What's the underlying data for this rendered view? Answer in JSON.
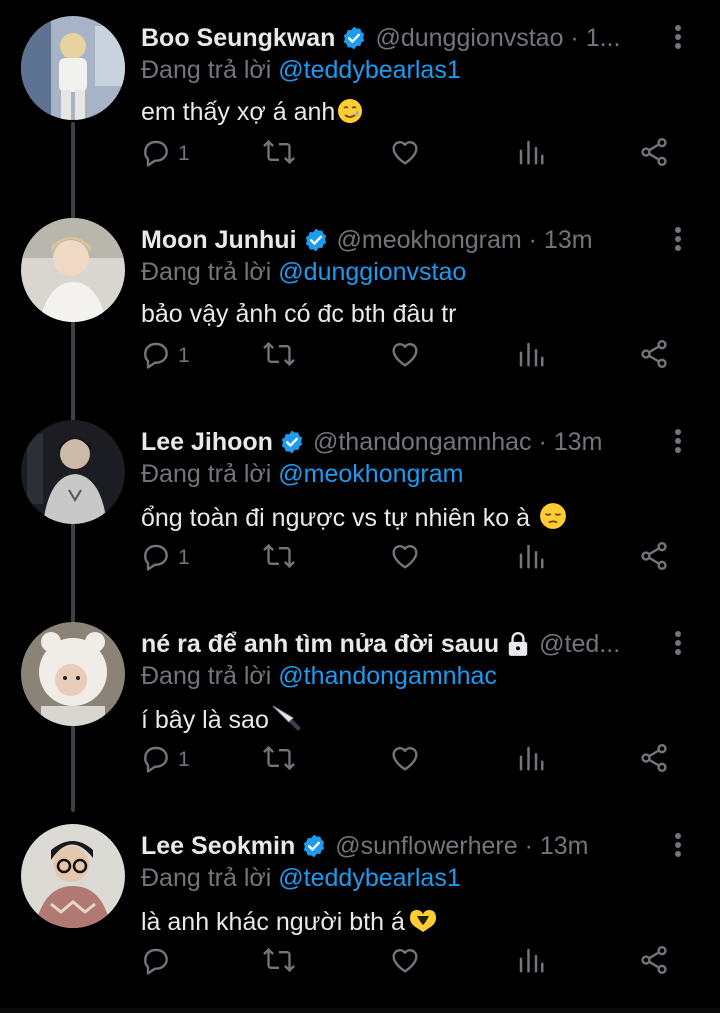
{
  "reply_prefix": "Đang trả lời",
  "colors": {
    "background": "#000000",
    "text": "#e7e9ea",
    "secondary": "#71767b",
    "accent": "#1d9bf0"
  },
  "tweets": [
    {
      "display_name": "Boo Seungkwan",
      "verified": true,
      "handle_time": "@dunggionvstao · 1...",
      "reply_to": "@teddybearlas1",
      "text": "em thấy xợ á anh",
      "emoji": "smiling-face-with-tear",
      "reply_count": "1",
      "avatar": "photo-person-standing"
    },
    {
      "display_name": "Moon Junhui",
      "verified": true,
      "handle_time": "@meokhongram · 13m",
      "reply_to": "@dunggionvstao",
      "text": "bảo vậy ảnh có đc bth đâu tr",
      "emoji": "",
      "reply_count": "1",
      "avatar": "photo-person-light"
    },
    {
      "display_name": "Lee Jihoon",
      "verified": true,
      "handle_time": "@thandongamnhac · 13m",
      "reply_to": "@meokhongram",
      "text": "ổng toàn đi ngược vs tự nhiên ko à",
      "emoji": "pensive-face",
      "reply_count": "1",
      "avatar": "photo-person-hoodie"
    },
    {
      "display_name": "né ra để anh tìm nửa đời sauu",
      "verified": false,
      "locked": true,
      "handle_time": "@ted...",
      "reply_to": "@thandongamnhac",
      "text": "í bây là sao",
      "emoji": "knife",
      "reply_count": "1",
      "avatar": "photo-person-hat"
    },
    {
      "display_name": "Lee Seokmin",
      "verified": true,
      "handle_time": "@sunflowerhere · 13m",
      "reply_to": "@teddybearlas1",
      "text": "là anh khác người bth á",
      "emoji": "heart-hands",
      "reply_count": "",
      "avatar": "photo-person-glasses"
    }
  ]
}
